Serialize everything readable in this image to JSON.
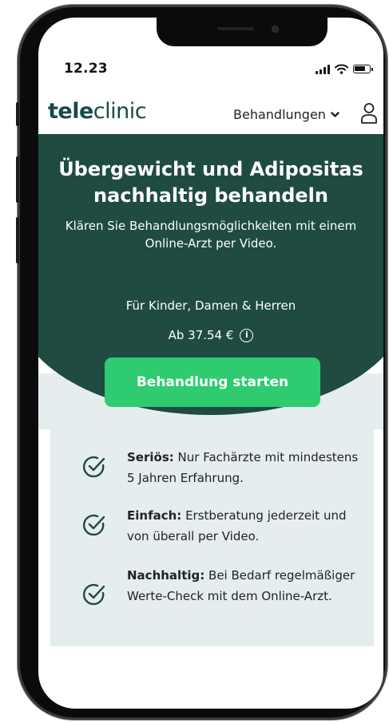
{
  "status_bar": {
    "time": "12.23"
  },
  "header": {
    "logo_bold": "tele",
    "logo_regular": "clinic",
    "nav_label": "Behandlungen"
  },
  "hero": {
    "title_line1": "Übergewicht und Adipositas",
    "title_line2": "nachhaltig behandeln",
    "subtitle": "Klären Sie Behandlungsmöglichkeiten mit einem Online-Arzt per Video.",
    "audience": "Für Kinder, Damen & Herren",
    "price": "Ab 37.54 €",
    "cta_label": "Behandlung starten"
  },
  "benefits": [
    {
      "title": "Seriös:",
      "text": "Nur Fachärzte mit mindestens 5 Jahren Erfahrung."
    },
    {
      "title": "Einfach:",
      "text": "Erstberatung jederzeit und von überall per Video."
    },
    {
      "title": "Nachhaltig:",
      "text": "Bei Bedarf regelmäßiger Werte-Check mit dem Online-Arzt."
    }
  ],
  "colors": {
    "brand_dark_green": "#1f4b41",
    "cta_green": "#2ecb71",
    "logo_teal": "#174a46",
    "light_panel": "#e6edee"
  }
}
